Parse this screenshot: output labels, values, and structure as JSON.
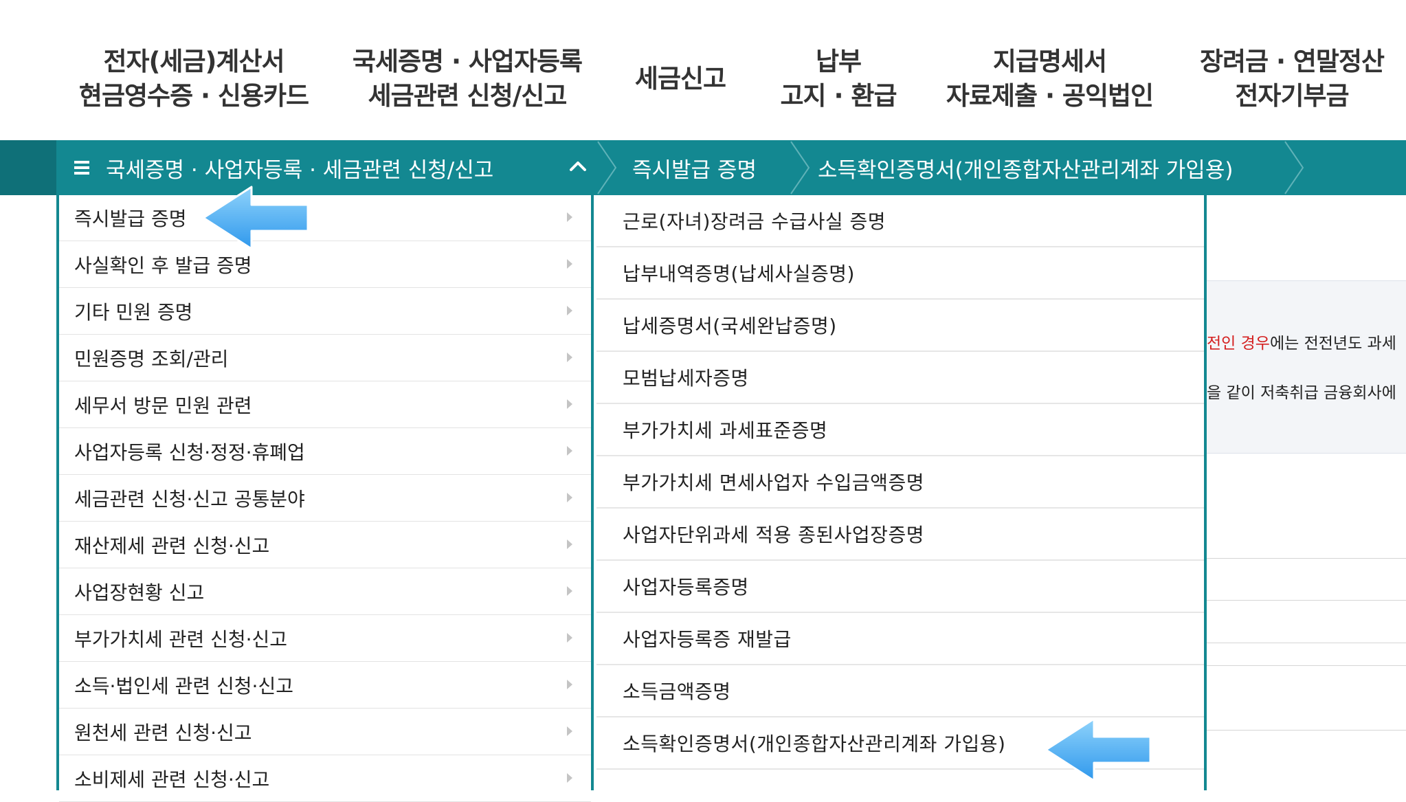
{
  "top_nav": [
    {
      "line1": "전자(세금)계산서",
      "line2": "현금영수증 · 신용카드"
    },
    {
      "line1": "국세증명 · 사업자등록",
      "line2": "세금관련 신청/신고"
    },
    {
      "line1": "세금신고",
      "line2": ""
    },
    {
      "line1": "납부",
      "line2": "고지 · 환급"
    },
    {
      "line1": "지급명세서",
      "line2": "자료제출 · 공익법인"
    },
    {
      "line1": "장려금 · 연말정산",
      "line2": "전자기부금"
    }
  ],
  "breadcrumb": {
    "section": "국세증명 · 사업자등록 · 세금관련 신청/신고",
    "level2": "즉시발급 증명",
    "level3": "소득확인증명서(개인종합자산관리계좌 가입용)"
  },
  "left_menu": [
    "즉시발급 증명",
    "사실확인 후 발급 증명",
    "기타 민원 증명",
    "민원증명 조회/관리",
    "세무서 방문 민원 관련",
    "사업자등록 신청·정정·휴폐업",
    "세금관련 신청·신고 공통분야",
    "재산제세 관련 신청·신고",
    "사업장현황 신고",
    "부가가치세 관련 신청·신고",
    "소득·법인세 관련 신청·신고",
    "원천세 관련 신청·신고",
    "소비제세 관련 신청·신고"
  ],
  "sub_menu": [
    "근로(자녀)장려금 수급사실 증명",
    "납부내역증명(납세사실증명)",
    "납세증명서(국세완납증명)",
    "모범납세자증명",
    "부가가치세 과세표준증명",
    "부가가치세 면세사업자 수입금액증명",
    "사업자단위과세 적용 종된사업장증명",
    "사업자등록증명",
    "사업자등록증 재발급",
    "소득금액증명",
    "소득확인증명서(개인종합자산관리계좌 가입용)"
  ],
  "background_page": {
    "line1_red": "전인 경우",
    "line1_rest": "에는 전전년도 과세",
    "line2": "을 같이 저축취급 금융회사에"
  },
  "colors": {
    "accent": "#138891",
    "accent_dark": "#0f7078",
    "arrow": "#3fa9f5",
    "emphasis_red": "#d42020"
  },
  "icons": {
    "menu": "hamburger-menu-icon",
    "collapse": "chevron-up-icon",
    "item_arrow": "chevron-right-icon",
    "annotation": "left-pointing-arrow-annotation"
  }
}
